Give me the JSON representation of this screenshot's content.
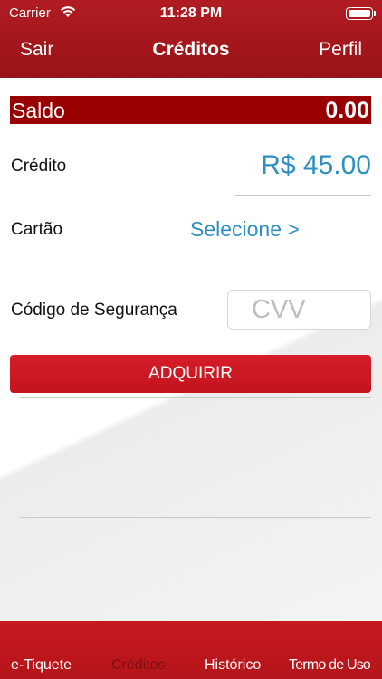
{
  "status_bar": {
    "carrier": "Carrier",
    "time": "11:28 PM"
  },
  "nav": {
    "left_label": "Sair",
    "title": "Créditos",
    "right_label": "Perfil"
  },
  "balance": {
    "label": "Saldo",
    "value": "0.00"
  },
  "credit": {
    "label": "Crédito",
    "value": "R$ 45.00"
  },
  "card": {
    "label": "Cartão",
    "value": "Selecione >"
  },
  "security_code": {
    "label": "Código de Segurança",
    "placeholder": "CVV"
  },
  "buy_button": {
    "label": "ADQUIRIR"
  },
  "tabs": [
    {
      "label": "e-Tiquete",
      "active": false
    },
    {
      "label": "Créditos",
      "active": true
    },
    {
      "label": "Histórico",
      "active": false
    },
    {
      "label": "Termo de Uso",
      "active": false
    }
  ],
  "colors": {
    "header_red": "#a3161b",
    "balance_bar": "#990000",
    "link_blue": "#2f8fc0",
    "button_red": "#d51d28",
    "active_tab": "#7a0f12"
  }
}
